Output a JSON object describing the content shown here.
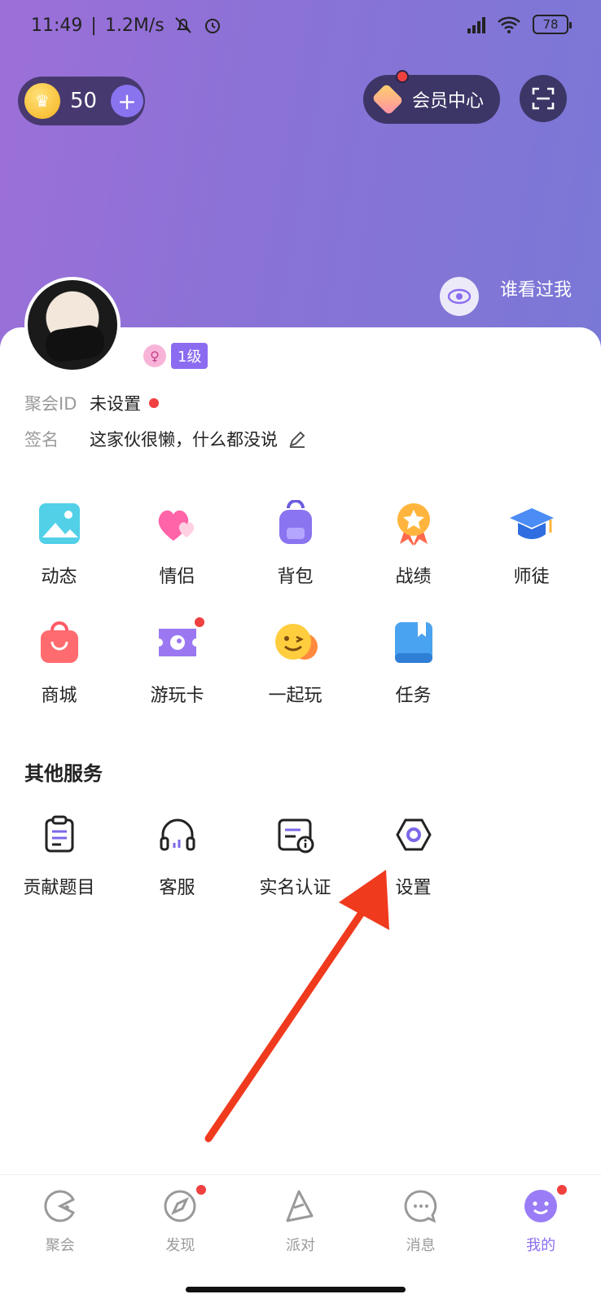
{
  "status_bar": {
    "time": "11:49",
    "speed": "1.2M/s",
    "battery": "78",
    "icons": [
      "mute-bell-icon",
      "alarm-icon",
      "hd-signal-icon",
      "wifi-icon",
      "battery-icon"
    ]
  },
  "header": {
    "coins": "50",
    "vip_label": "会员中心",
    "visitor_label": "谁看过我"
  },
  "profile": {
    "level": "1级",
    "id_key": "聚会ID",
    "id_val": "未设置",
    "sign_key": "签名",
    "sign_val": "这家伙很懒，什么都没说"
  },
  "features": [
    {
      "label": "动态",
      "icon": "photo-icon"
    },
    {
      "label": "情侣",
      "icon": "hearts-icon"
    },
    {
      "label": "背包",
      "icon": "backpack-icon"
    },
    {
      "label": "战绩",
      "icon": "medal-icon"
    },
    {
      "label": "师徒",
      "icon": "graduation-cap-icon"
    },
    {
      "label": "商城",
      "icon": "shopping-bag-icon"
    },
    {
      "label": "游玩卡",
      "icon": "ticket-icon",
      "badge": true
    },
    {
      "label": "一起玩",
      "icon": "smile-wink-icon"
    },
    {
      "label": "任务",
      "icon": "task-book-icon"
    }
  ],
  "other_services": {
    "title": "其他服务",
    "items": [
      {
        "label": "贡献题目",
        "icon": "clipboard-icon"
      },
      {
        "label": "客服",
        "icon": "headset-icon"
      },
      {
        "label": "实名认证",
        "icon": "id-card-icon"
      },
      {
        "label": "设置",
        "icon": "settings-hexagon-icon"
      }
    ]
  },
  "nav": [
    {
      "label": "聚会",
      "icon": "pacman-icon"
    },
    {
      "label": "发现",
      "icon": "compass-icon",
      "badge": true
    },
    {
      "label": "派对",
      "icon": "party-hat-icon"
    },
    {
      "label": "消息",
      "icon": "chat-bubble-icon"
    },
    {
      "label": "我的",
      "icon": "me-face-icon",
      "badge": true,
      "active": true
    }
  ],
  "colors": {
    "accent": "#8b6cf1",
    "hero_start": "#9c6fd8",
    "hero_end": "#7a78d6",
    "badge_red": "#f04040",
    "arrow_red": "#f03a1e"
  }
}
